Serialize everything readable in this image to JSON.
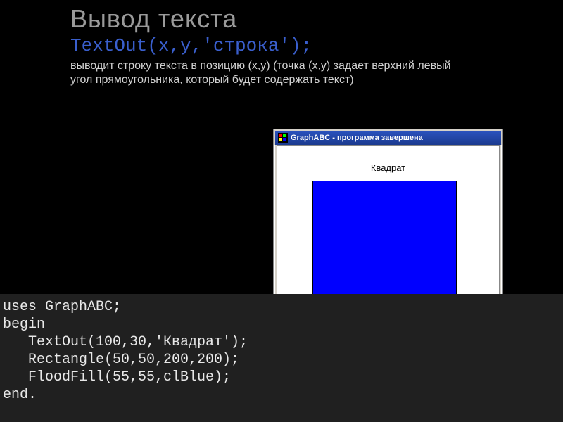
{
  "title": "Вывод текста",
  "syntax": "TextOut(x,y,'строка');",
  "description": "выводит строку текста в позицию (x,y) (точка (x,y) задает верхний левый угол прямоугольника, который будет содержать текст)",
  "window": {
    "title": "GraphABC - программа завершена",
    "output_label": "Квадрат"
  },
  "code": {
    "l1": "uses GraphABC;",
    "l2": "begin",
    "l3": "   TextOut(100,30,'Квадрат');",
    "l4": "   Rectangle(50,50,200,200);",
    "l5": "   FloodFill(55,55,clBlue);",
    "l6": "end."
  }
}
